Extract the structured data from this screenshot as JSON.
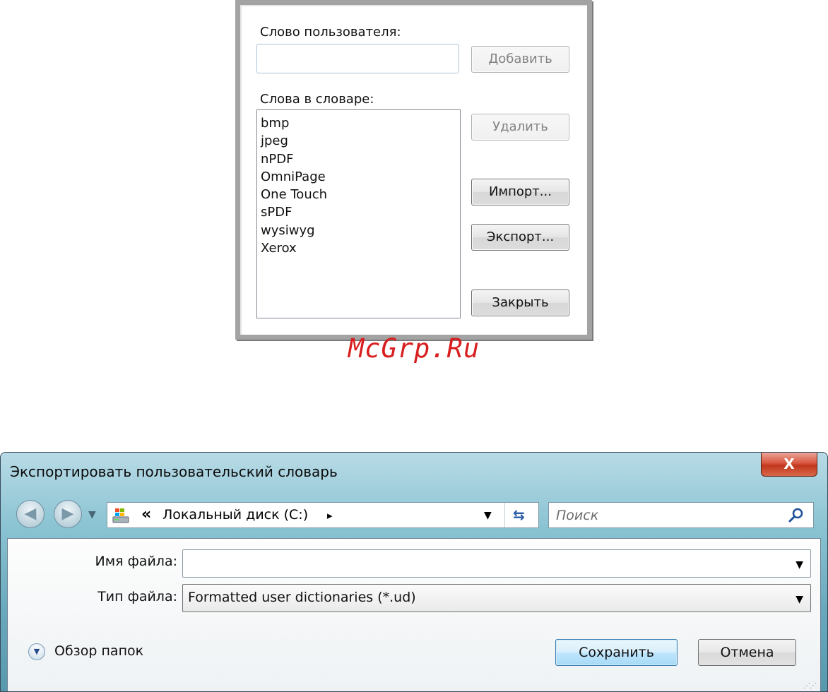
{
  "dictionary_dialog": {
    "user_word_label": "Слово пользователя:",
    "user_word_value": "",
    "add_button": "Добавить",
    "words_label": "Слова в словаре:",
    "words": [
      "bmp",
      "jpeg",
      "nPDF",
      "OmniPage",
      "One Touch",
      "sPDF",
      "wysiwyg",
      "Xerox"
    ],
    "delete_button": "Удалить",
    "import_button": "Импорт...",
    "export_button": "Экспорт...",
    "close_button": "Закрыть"
  },
  "watermark": "McGrp.Ru",
  "export_dialog": {
    "title": "Экспортировать пользовательский словарь",
    "close_glyph": "X",
    "address": {
      "chevron": "«",
      "path": "Локальный диск (C:)",
      "path_arrow": "▸",
      "icon": "drive-icon"
    },
    "search_placeholder": "Поиск",
    "filename_label": "Имя файла:",
    "filename_value": "",
    "filetype_label": "Тип файла:",
    "filetype_value": "Formatted user dictionaries (*.ud)",
    "browse_folders": "Обзор папок",
    "save_button": "Сохранить",
    "cancel_button": "Отмена"
  },
  "colors": {
    "watermark": "#d81e1e",
    "dialog_frame": "#a3a3a3",
    "window_glass": "#8cc4d3",
    "close_button": "#c1361d"
  }
}
